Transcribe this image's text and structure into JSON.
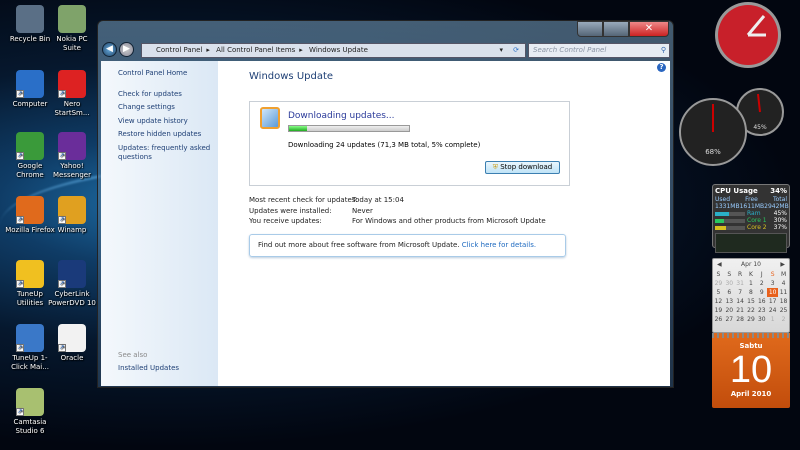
{
  "desktop_icons": [
    {
      "label": "Recycle Bin",
      "color": "#5a6f86"
    },
    {
      "label": "Nokia PC Suite",
      "color": "#7fa36a"
    },
    {
      "label": "Computer",
      "color": "#2a6fc8"
    },
    {
      "label": "Nero StartSm...",
      "color": "#d22"
    },
    {
      "label": "Google Chrome",
      "color": "#3a9a3a"
    },
    {
      "label": "Yahoo! Messenger",
      "color": "#6a2d9a"
    },
    {
      "label": "Mozilla Firefox",
      "color": "#e06a1c"
    },
    {
      "label": "Winamp",
      "color": "#e0a020"
    },
    {
      "label": "TuneUp Utilities",
      "color": "#f0c020"
    },
    {
      "label": "CyberLink PowerDVD 10",
      "color": "#1a3a7a"
    },
    {
      "label": "TuneUp 1-Click Mai...",
      "color": "#3a78c8"
    },
    {
      "label": "Oracle",
      "color": "#f2f2f2"
    },
    {
      "label": "Camtasia Studio 6",
      "color": "#a8c070"
    }
  ],
  "window": {
    "breadcrumb": [
      "Control Panel",
      "All Control Panel Items",
      "Windows Update"
    ],
    "search_placeholder": "Search Control Panel",
    "sidebar": {
      "home": "Control Panel Home",
      "links": [
        "Check for updates",
        "Change settings",
        "View update history",
        "Restore hidden updates",
        "Updates: frequently asked questions"
      ],
      "see_also": "See also",
      "installed": "Installed Updates"
    },
    "title": "Windows Update",
    "status": {
      "heading": "Downloading updates...",
      "progress_percent": 5,
      "detail": "Downloading 24 updates (71,3 MB total, 5% complete)",
      "stop_button": "Stop download"
    },
    "info": [
      {
        "k": "Most recent check for updates:",
        "v": "Today at 15:04"
      },
      {
        "k": "Updates were installed:",
        "v": "Never"
      },
      {
        "k": "You receive updates:",
        "v": "For Windows and other products from Microsoft Update"
      }
    ],
    "notice": {
      "text": "Find out more about free software from Microsoft Update.",
      "link": "Click here for details."
    }
  },
  "gadgets": {
    "cpu_meter": {
      "cpu": "68%",
      "mem": "45%"
    },
    "cpu_usage": {
      "title": "CPU Usage",
      "total_pct": "34%",
      "headers": [
        "Used",
        "Free",
        "Total"
      ],
      "values": [
        "1331MB",
        "1611MB",
        "2942MB"
      ],
      "bars": [
        {
          "label": "Ram",
          "pct": "45%",
          "color": "#2ab0c8"
        },
        {
          "label": "Core 1",
          "pct": "30%",
          "color": "#2ac860"
        },
        {
          "label": "Core 2",
          "pct": "37%",
          "color": "#d8c020"
        }
      ]
    },
    "calendar": {
      "month": "Apr 10",
      "days": [
        "S",
        "S",
        "R",
        "K",
        "J",
        "S",
        "M"
      ],
      "weeks": [
        [
          "29",
          "30",
          "31",
          "1",
          "2",
          "3",
          "4"
        ],
        [
          "5",
          "6",
          "7",
          "8",
          "9",
          "10",
          "11"
        ],
        [
          "12",
          "13",
          "14",
          "15",
          "16",
          "17",
          "18"
        ],
        [
          "19",
          "20",
          "21",
          "22",
          "23",
          "24",
          "25"
        ],
        [
          "26",
          "27",
          "28",
          "29",
          "30",
          "1",
          "2"
        ]
      ],
      "day_name": "Sabtu",
      "day": "10",
      "month_year": "April 2010"
    }
  }
}
